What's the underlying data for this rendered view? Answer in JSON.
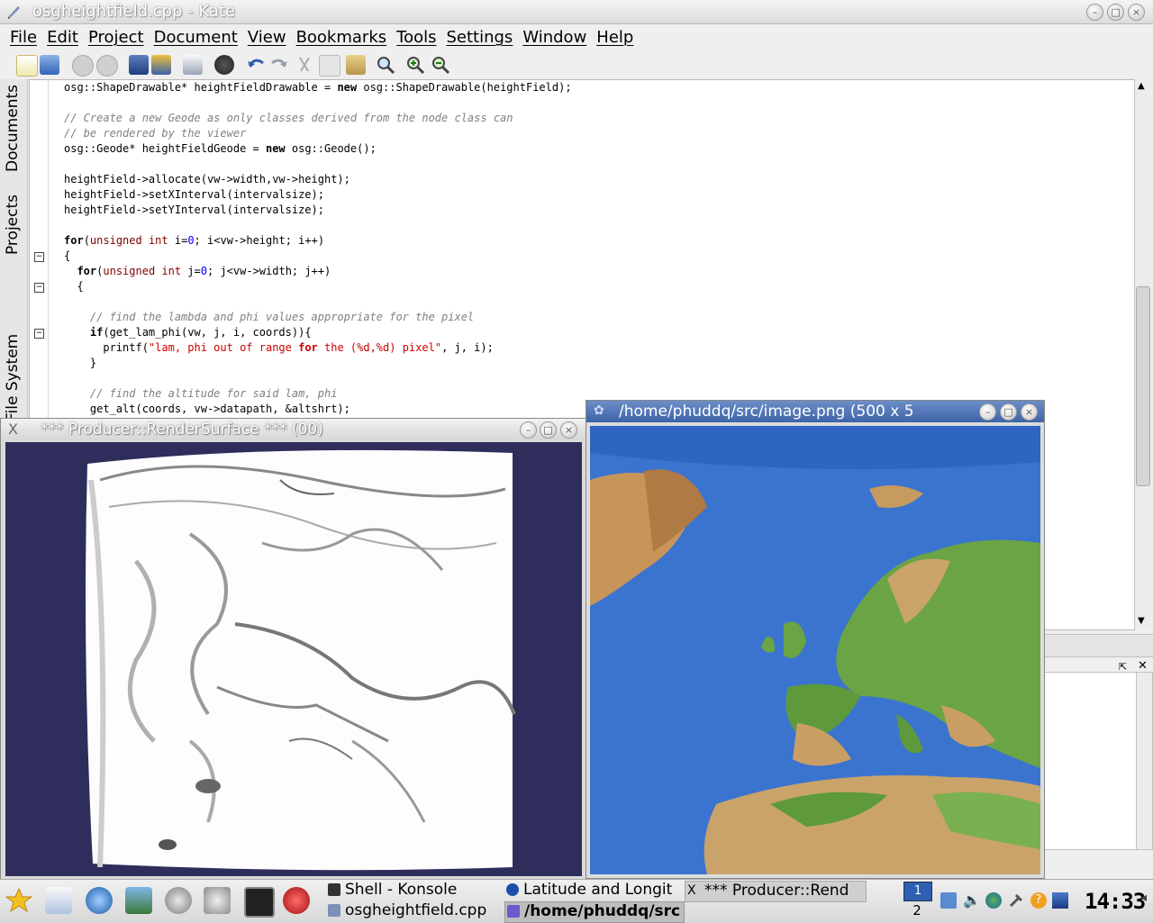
{
  "kate": {
    "title": "osgheightfield.cpp - Kate",
    "menu": [
      "File",
      "Edit",
      "Project",
      "Document",
      "View",
      "Bookmarks",
      "Tools",
      "Settings",
      "Window",
      "Help"
    ],
    "toolbar_icons": [
      "new-file-icon",
      "open-file-icon",
      "back-icon",
      "forward-icon",
      "save-icon",
      "save-all-icon",
      "print-icon",
      "close-document-icon",
      "undo-icon",
      "redo-icon",
      "cut-icon",
      "copy-icon",
      "paste-icon",
      "find-icon",
      "zoom-in-icon",
      "zoom-out-icon"
    ],
    "side_tabs": [
      "Documents",
      "Projects",
      "File System Browser"
    ],
    "code_lines": [
      "osg::ShapeDrawable* heightFieldDrawable = new osg::ShapeDrawable(heightField);",
      "",
      "// Create a new Geode as only classes derived from the node class can",
      "// be rendered by the viewer",
      "osg::Geode* heightFieldGeode = new osg::Geode();",
      "",
      "heightField->allocate(vw->width,vw->height);",
      "heightField->setXInterval(intervalsize);",
      "heightField->setYInterval(intervalsize);",
      "",
      "for(unsigned int i=0; i<vw->height; i++)",
      "{",
      "  for(unsigned int j=0; j<vw->width; j++)",
      "  {",
      "",
      "    // find the lambda and phi values appropriate for the pixel",
      "    if(get_lam_phi(vw, j, i, coords)){",
      "      printf(\"lam, phi out of range for the (%d,%d) pixel\", j, i);",
      "    }",
      "",
      "    // find the altitude for said lam, phi",
      "    get_alt(coords, vw->datapath, &altshrt);"
    ]
  },
  "producer": {
    "title": "*** Producer::RenderSurface ***  (00)"
  },
  "image_viewer": {
    "title": "/home/phuddq/src/image.png (500 x 5"
  },
  "taskbar": {
    "tasks_top": [
      "Shell - Konsole",
      "Latitude and Longit",
      "*** Producer::Rend"
    ],
    "tasks_bottom": [
      "osgheightfield.cpp",
      "/home/phuddq/src"
    ],
    "desktop_current": "1",
    "desktop_other": "2",
    "clock": "14:33"
  }
}
